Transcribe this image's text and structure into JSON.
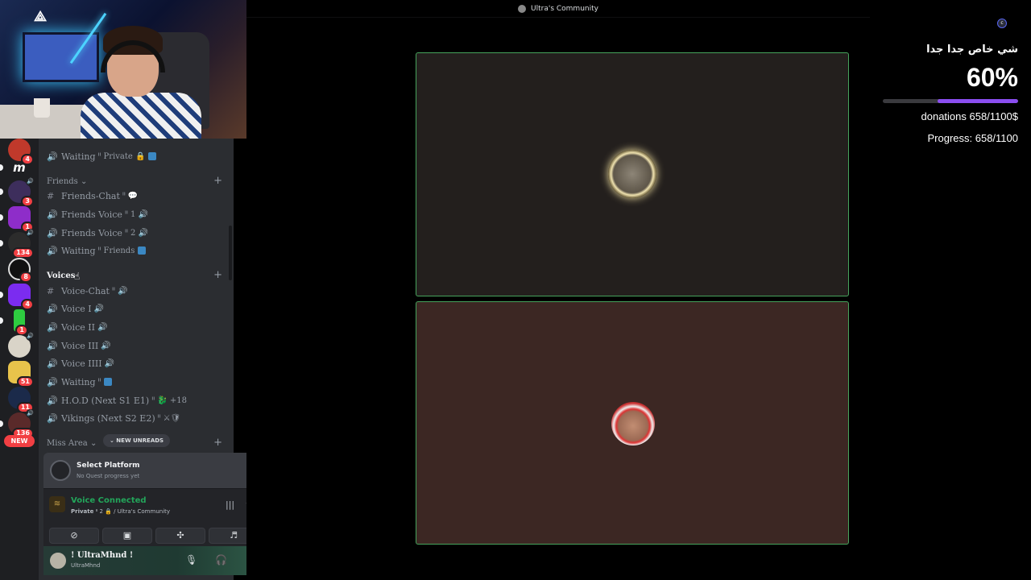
{
  "stage": {
    "server_title": "Ultra's Community"
  },
  "overlay": {
    "title": "شي خاص جدا جدا",
    "percent_text": "60%",
    "progress_fraction": 0.598,
    "donations_text": "donations 658/1100$",
    "progress_text": "Progress: 658/1100",
    "accent_color": "#8b4ef0",
    "corner_label": "c"
  },
  "guilds": {
    "badges": [
      "4",
      "3",
      "1",
      "134",
      "8",
      "4",
      "1",
      "51",
      "11",
      "136"
    ],
    "new_label": "NEW"
  },
  "channels": {
    "top_item": {
      "name": "Waiting",
      "suffix": "ᐦ Private 🔒"
    },
    "friends_category": "Friends ⌄",
    "friends": [
      {
        "icon": "#",
        "name": "Friends-Chat",
        "suffix": "ᐦ 💬"
      },
      {
        "icon": "🔊",
        "name": "Friends Voice",
        "suffix": "ᐦ 1 🔊"
      },
      {
        "icon": "🔊",
        "name": "Friends Voice",
        "suffix": "ᐦ 2 🔊"
      },
      {
        "icon": "🔊",
        "name": "Waiting",
        "suffix": "ᐦ Friends"
      }
    ],
    "voices_category": "Voices",
    "voices": [
      {
        "icon": "#",
        "name": "Voice-Chat",
        "suffix": "ᐦ 🔊"
      },
      {
        "icon": "🔊",
        "name": "Voice I",
        "suffix": "🔊"
      },
      {
        "icon": "🔊",
        "name": "Voice II",
        "suffix": "🔊"
      },
      {
        "icon": "🔊",
        "name": "Voice III",
        "suffix": "🔊"
      },
      {
        "icon": "🔊",
        "name": "Voice IIII",
        "suffix": "🔊"
      },
      {
        "icon": "🔊",
        "name": "Waiting",
        "suffix": "ᐦ"
      },
      {
        "icon": "🔊",
        "name": "H.O.D (Next S1 E1)",
        "suffix": "ᐦ 🐉 +18"
      },
      {
        "icon": "🔊",
        "name": "Vikings (Next S2 E2)",
        "suffix": "ᐦ ⚔🛡"
      }
    ],
    "miss_category": "Miss Area ⌄",
    "new_unreads": "⌄ NEW UNREADS"
  },
  "quest": {
    "title": "Select Platform",
    "subtitle": "No Quest progress yet"
  },
  "voice": {
    "status": "Voice Connected",
    "channel_prefix": "Private",
    "channel_detail": "ᐦ 2 🔒 / Ultra's Community"
  },
  "user": {
    "display_name": "! UltraMhnd !",
    "username": "UltraMhnd"
  }
}
